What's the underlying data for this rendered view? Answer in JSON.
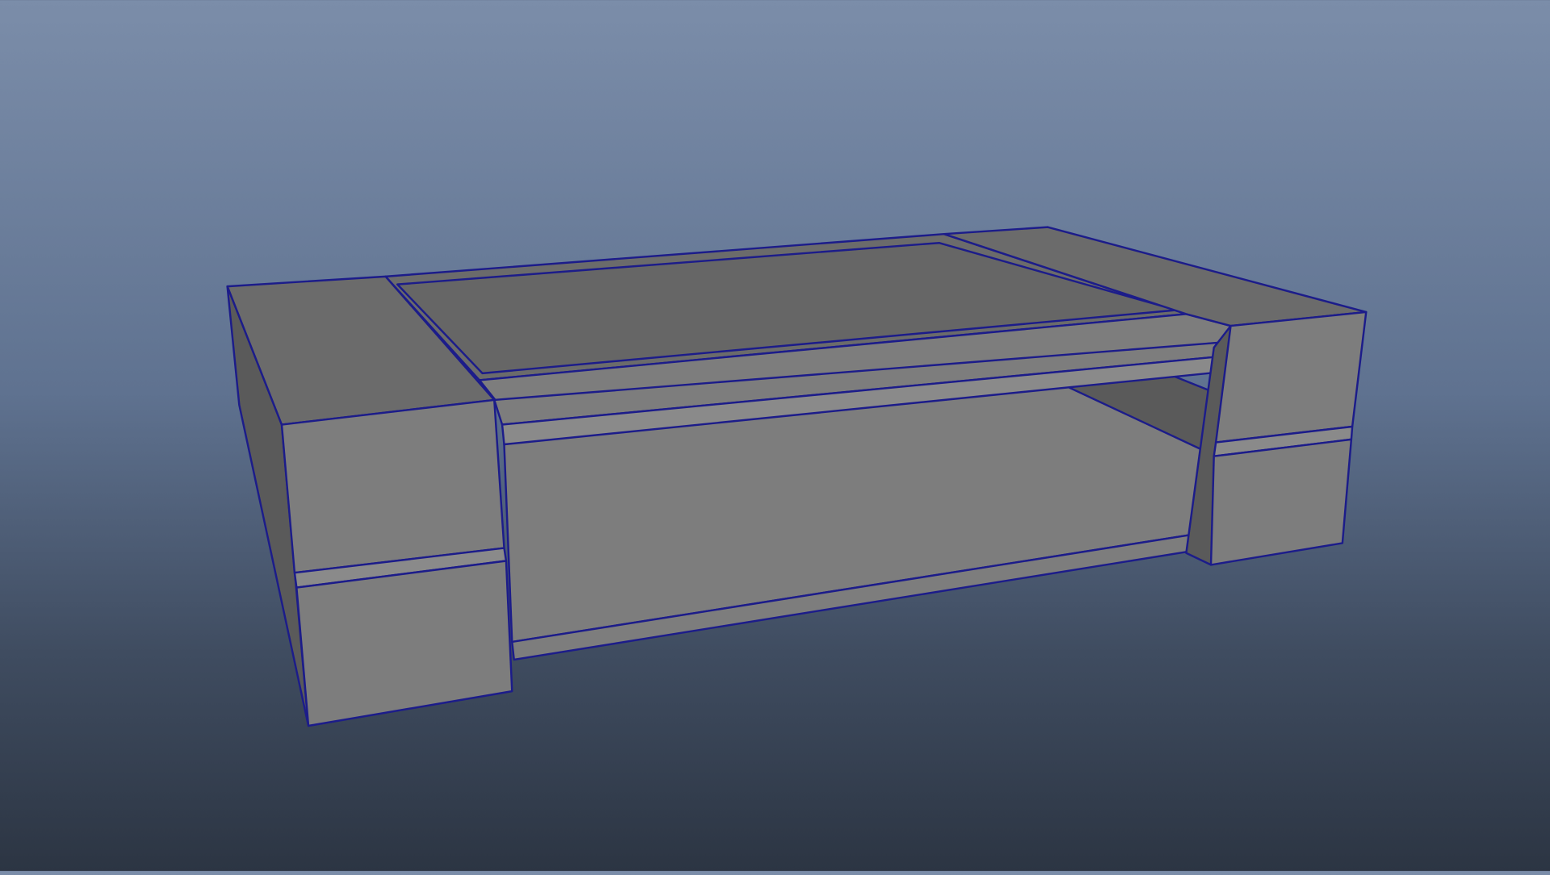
{
  "viewport": {
    "subject": "coffee-table-model",
    "colors": {
      "background_top": "#7b8da9",
      "background_bottom": "#2c3543",
      "face_light": "#7d7d7d",
      "face_top": "#6b6b6b",
      "face_dark": "#5a5a5a",
      "edge": "#1c1c8a"
    }
  }
}
